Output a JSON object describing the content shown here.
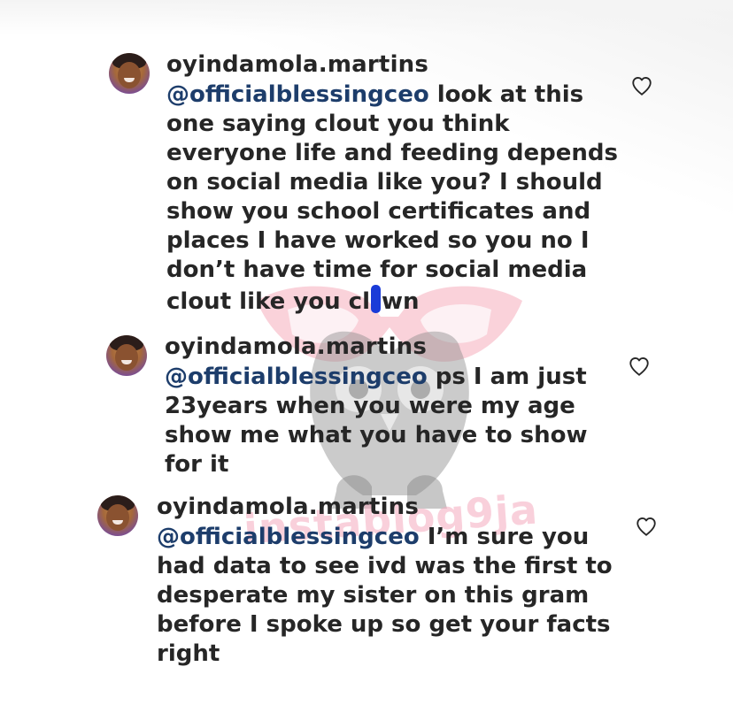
{
  "comments": [
    {
      "username": "oyindamola.martins",
      "mention": "@officialblessingceo",
      "text_before_censor": " look at this\none saying clout you think\neveryone life and feeding depends\non social media like you? I should\nshow you school certificates and\nplaces I have worked so you no I\ndon’t have time for social media\nclout like you cl",
      "text_after_censor": "wn",
      "like_icon": "heart-outline-icon"
    },
    {
      "username": "oyindamola.martins",
      "mention": "@officialblessingceo",
      "text": " ps I am just\n23years when you were my age\nshow me what you have to show\nfor it",
      "like_icon": "heart-outline-icon"
    },
    {
      "username": "oyindamola.martins",
      "mention": "@officialblessingceo",
      "text": " I’m sure you\nhad data to see ivd was the first to\ndesperate my sister on this gram\nbefore I spoke up so get your facts\nright",
      "like_icon": "heart-outline-icon"
    }
  ],
  "watermark": {
    "text": "instablog9ja",
    "icon": "owl-logo-icon"
  },
  "colors": {
    "text": "#262626",
    "mention": "#1d3d6b",
    "censor": "#1a3bd8",
    "watermark_pink": "#f4aabe"
  }
}
